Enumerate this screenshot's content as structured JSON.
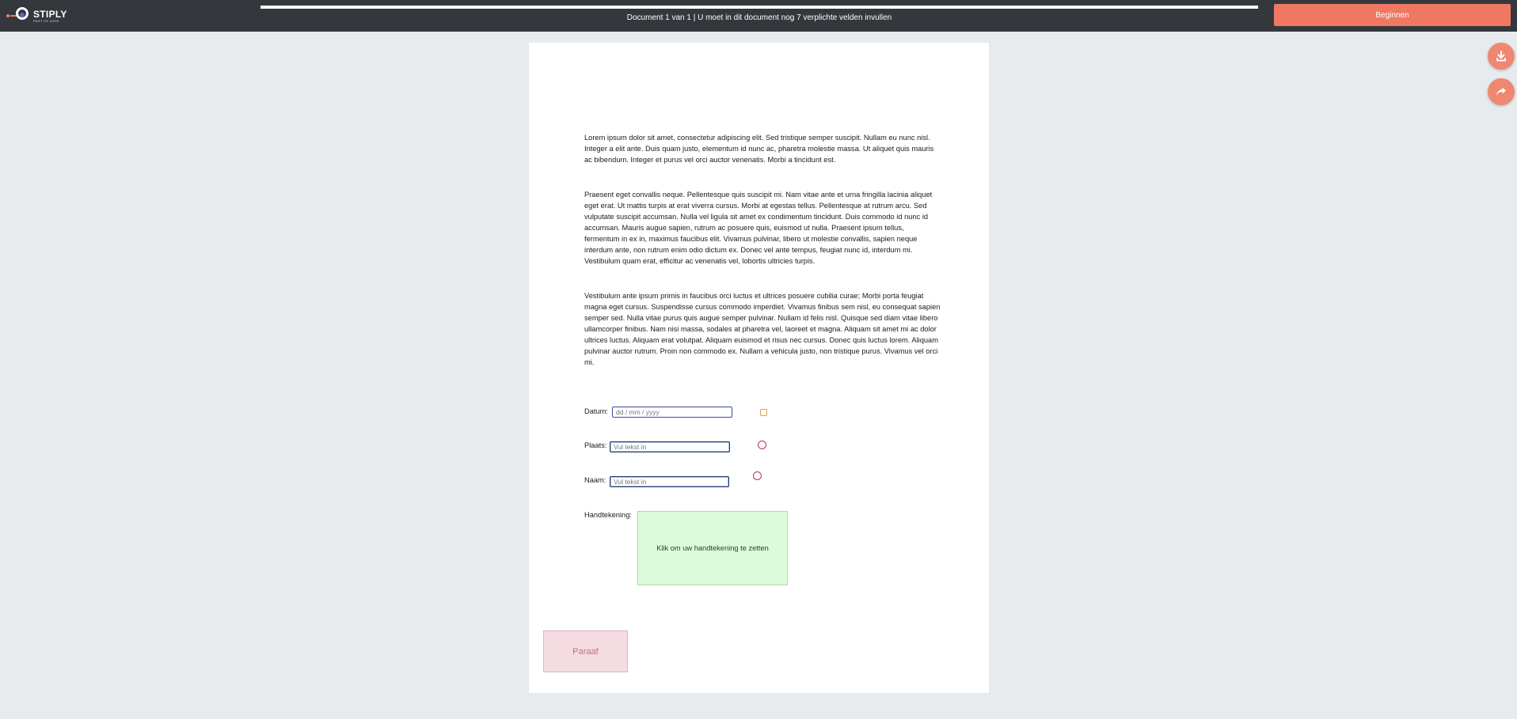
{
  "app": {
    "logo_name": "STIPLY",
    "logo_sub": "PART OF ASSE"
  },
  "topbar": {
    "progress": 0,
    "status_text": "Document 1 van 1 | U moet in dit document nog 7 verplichte velden invullen",
    "begin_label": "Beginnen"
  },
  "document": {
    "paragraphs": [
      "Lorem ipsum dolor sit amet, consectetur adipiscing elit. Sed tristique semper suscipit. Nullam eu nunc nisl. Integer a elit ante. Duis quam justo, elementum id nunc ac, pharetra molestie massa. Ut aliquet quis mauris ac bibendum. Integer et purus vel orci auctor venenatis. Morbi a tincidunt est.",
      "Praesent eget convallis neque. Pellentesque quis suscipit mi. Nam vitae ante et urna fringilla lacinia aliquet eget erat. Ut mattis turpis at erat viverra cursus. Morbi at egestas tellus. Pellentesque at rutrum arcu. Sed vulputate suscipit accumsan. Nulla vel ligula sit amet ex condimentum tincidunt. Duis commodo id nunc id accumsan. Mauris augue sapien, rutrum ac posuere quis, euismod ut nulla. Praesent ipsum tellus, fermentum in ex in, maximus faucibus elit. Vivamus pulvinar, libero ut molestie convallis, sapien neque interdum ante, non rutrum enim odio dictum ex. Donec vel ante tempus, feugiat nunc id, interdum mi. Vestibulum quam erat, efficitur ac venenatis vel, lobortis ultricies turpis.",
      "Vestibulum ante ipsum primis in faucibus orci luctus et ultrices posuere cubilia curae; Morbi porta feugiat magna eget cursus. Suspendisse cursus commodo imperdiet. Vivamus finibus sem nisl, eu consequat sapien semper sed. Nulla vitae purus quis augue semper pulvinar. Nullam id felis nisl. Quisque sed diam vitae libero ullamcorper finibus. Nam nisi massa, sodales at pharetra vel, laoreet et magna. Aliquam sit amet mi ac dolor ultrices luctus. Aliquam erat volutpat. Aliquam euismod et risus nec cursus. Donec quis luctus lorem. Aliquam pulvinar auctor rutrum. Proin non commodo ex. Nullam a vehicula justo, non tristique purus. Vivamus vel orci mi."
    ],
    "fields": {
      "datum_label": "Datum:",
      "datum_placeholder": "dd / mm / yyyy",
      "plaats_label": "Plaats:",
      "plaats_placeholder": "Vul tekst in",
      "naam_label": "Naam:",
      "naam_placeholder": "Vul tekst in",
      "handtekening_label": "Handtekening:",
      "signature_prompt": "Klik om uw handtekening te zetten",
      "paraaf_label": "Paraaf"
    }
  },
  "actions": {
    "download_icon": "download-icon",
    "share_icon": "share-icon"
  },
  "colors": {
    "topbar": "#34383d",
    "accent": "#f07863",
    "signature_bg": "#dcfcd9",
    "paraaf_bg": "#f5dce2"
  }
}
